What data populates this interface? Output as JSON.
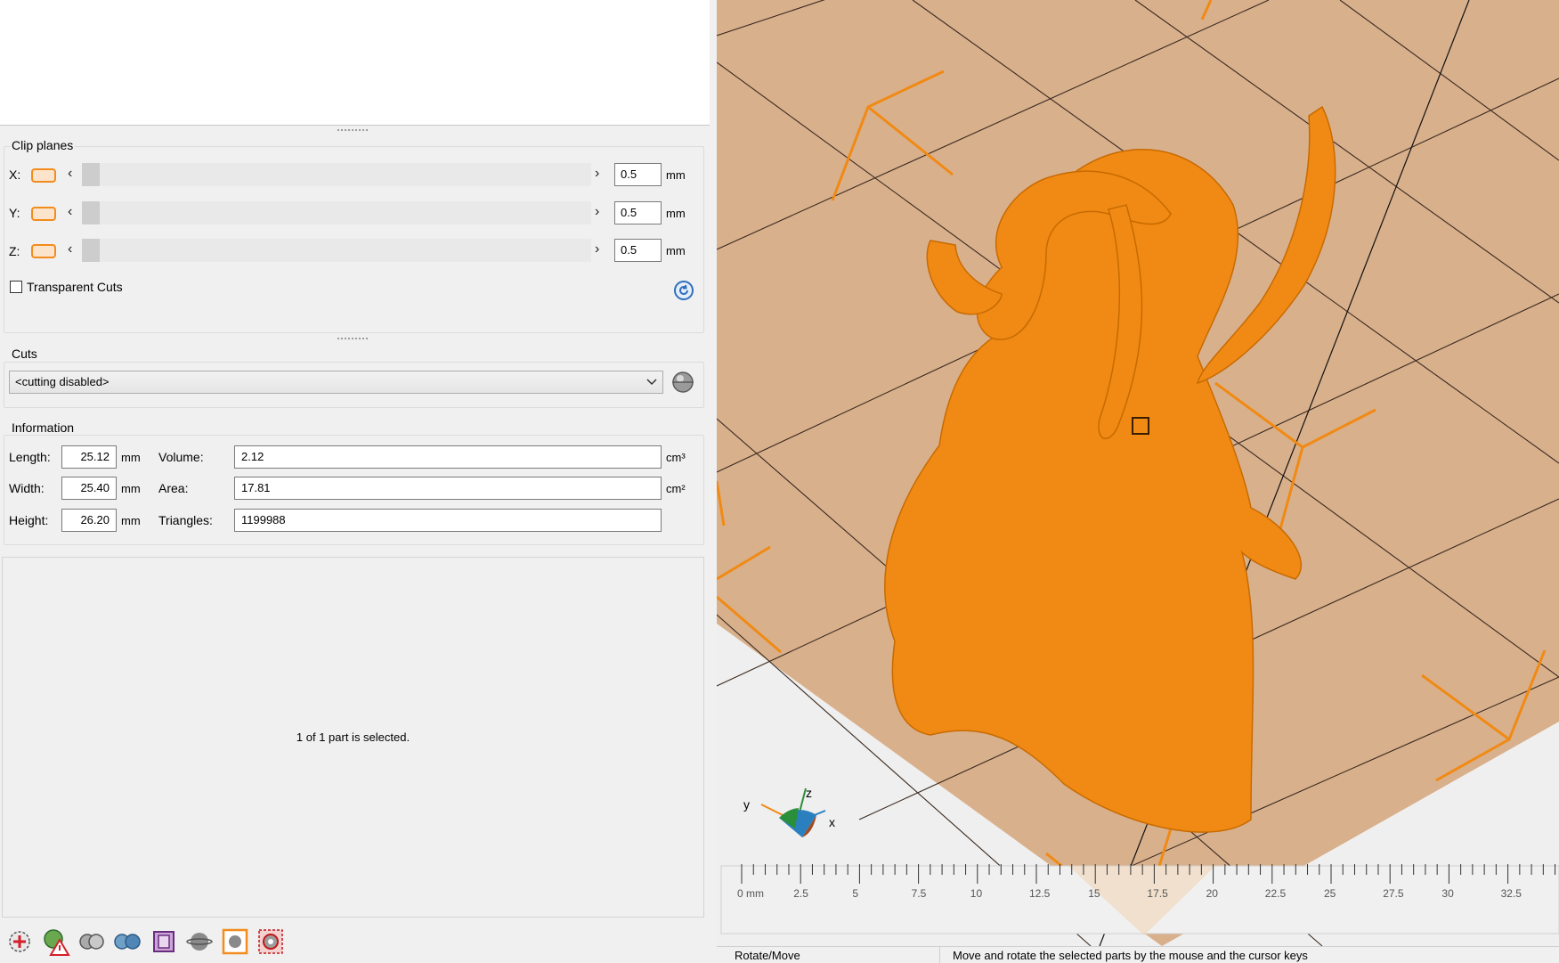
{
  "clip_planes": {
    "title": "Clip planes",
    "rows": [
      {
        "axis": "X:",
        "value": "0.5",
        "unit": "mm"
      },
      {
        "axis": "Y:",
        "value": "0.5",
        "unit": "mm"
      },
      {
        "axis": "Z:",
        "value": "0.5",
        "unit": "mm"
      }
    ],
    "transparent_cuts_label": "Transparent Cuts",
    "transparent_cuts_checked": false
  },
  "cuts": {
    "title": "Cuts",
    "selected": "<cutting disabled>"
  },
  "information": {
    "title": "Information",
    "length_label": "Length:",
    "length": "25.12",
    "length_unit": "mm",
    "width_label": "Width:",
    "width": "25.40",
    "width_unit": "mm",
    "height_label": "Height:",
    "height": "26.20",
    "height_unit": "mm",
    "volume_label": "Volume:",
    "volume": "2.12",
    "volume_unit": "cm³",
    "area_label": "Area:",
    "area": "17.81",
    "area_unit": "cm²",
    "triangles_label": "Triangles:",
    "triangles": "1199988"
  },
  "selection_text": "1 of 1 part is selected.",
  "toolbar": {
    "icons": [
      "add-part-icon",
      "repair-warning-icon",
      "merge-parts-icon",
      "split-parts-icon",
      "wall-thickness-icon",
      "sphere-view-icon",
      "selected-view-icon",
      "settings-gear-icon"
    ]
  },
  "viewport": {
    "axis_labels": {
      "x": "x",
      "y": "y",
      "z": "z"
    },
    "ruler_labels": [
      "0 mm",
      "2.5",
      "5",
      "7.5",
      "10",
      "12.5",
      "15",
      "17.5",
      "20",
      "22.5",
      "25",
      "27.5",
      "30",
      "32.5"
    ],
    "model_color": "#f08a14",
    "bed_color": "#d9b08c"
  },
  "status": {
    "mode": "Rotate/Move",
    "hint": "Move and rotate the selected parts by the mouse and the cursor keys"
  }
}
